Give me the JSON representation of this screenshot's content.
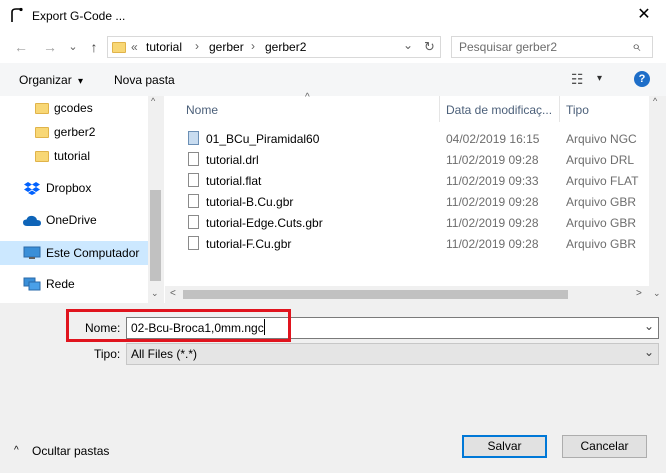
{
  "window": {
    "title": "Export G-Code ...",
    "close_glyph": "✕"
  },
  "navigation": {
    "back_icon": "←",
    "forward_icon": "→",
    "recent_icon": "⌄",
    "up_icon": "↑"
  },
  "address": {
    "overflow": "«",
    "crumbs": [
      "tutorial",
      "gerber",
      "gerber2"
    ],
    "separator": "›",
    "dropdown_glyph": "⌄",
    "refresh_glyph": "↻"
  },
  "search": {
    "placeholder": "Pesquisar gerber2",
    "icon_glyph": "⌕"
  },
  "toolbar": {
    "organize": "Organizar",
    "organize_caret": "▾",
    "new_folder": "Nova pasta",
    "view_glyph": "☷",
    "view_caret": "▾",
    "help": "?"
  },
  "nav_pane": {
    "folders": [
      "gcodes",
      "gerber2",
      "tutorial"
    ],
    "dropbox": "Dropbox",
    "onedrive": "OneDrive",
    "this_pc": "Este Computador",
    "network": "Rede"
  },
  "file_list": {
    "sort_glyph": "^",
    "columns": {
      "name": "Nome",
      "date": "Data de modificaç...",
      "type": "Tipo"
    },
    "rows": [
      {
        "name": "01_BCu_Piramidal60",
        "date": "04/02/2019 16:15",
        "type": "Arquivo NGC"
      },
      {
        "name": "tutorial.drl",
        "date": "11/02/2019 09:28",
        "type": "Arquivo DRL"
      },
      {
        "name": "tutorial.flat",
        "date": "11/02/2019 09:33",
        "type": "Arquivo FLAT"
      },
      {
        "name": "tutorial-B.Cu.gbr",
        "date": "11/02/2019 09:28",
        "type": "Arquivo GBR"
      },
      {
        "name": "tutorial-Edge.Cuts.gbr",
        "date": "11/02/2019 09:28",
        "type": "Arquivo GBR"
      },
      {
        "name": "tutorial-F.Cu.gbr",
        "date": "11/02/2019 09:28",
        "type": "Arquivo GBR"
      }
    ]
  },
  "scroll_glyphs": {
    "up": "^",
    "down": "⌄",
    "left": "<",
    "right": ">"
  },
  "form": {
    "name_label": "Nome:",
    "name_value": "02-Bcu-Broca1,0mm.ngc",
    "type_label": "Tipo:",
    "type_value": "All Files (*.*)",
    "dropdown_glyph": "⌄"
  },
  "footer": {
    "hide_folders": "Ocultar pastas",
    "hide_folders_glyph": "^",
    "save": "Salvar",
    "cancel": "Cancelar"
  },
  "colors": {
    "highlight": "#e0141e",
    "accent": "#0078d7",
    "folder": "#f8d775"
  }
}
